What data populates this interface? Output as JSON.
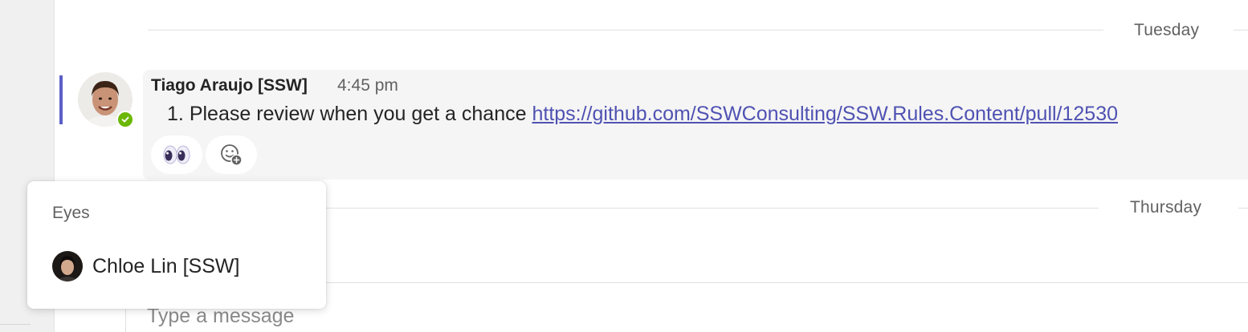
{
  "dividers": {
    "first_day": "Tuesday",
    "second_day": "Thursday"
  },
  "message": {
    "author": "Tiago Araujo [SSW]",
    "time": "4:45 pm",
    "list_number": "1.",
    "text": "Please review when you get a chance",
    "link": "https://github.com/SSWConsulting/SSW.Rules.Content/pull/12530",
    "presence": "available",
    "reactions": [
      {
        "emoji": "eyes",
        "icon": "eyes-emoji-icon"
      },
      {
        "emoji": "add-reaction",
        "icon": "add-reaction-icon"
      }
    ]
  },
  "reaction_popup": {
    "title": "Eyes",
    "users": [
      {
        "name": "Chloe Lin [SSW]"
      }
    ]
  },
  "compose": {
    "placeholder": "Type a message"
  },
  "colors": {
    "accent": "#5b5fc7",
    "link": "#4f52b2",
    "presence_available": "#6bb700"
  }
}
